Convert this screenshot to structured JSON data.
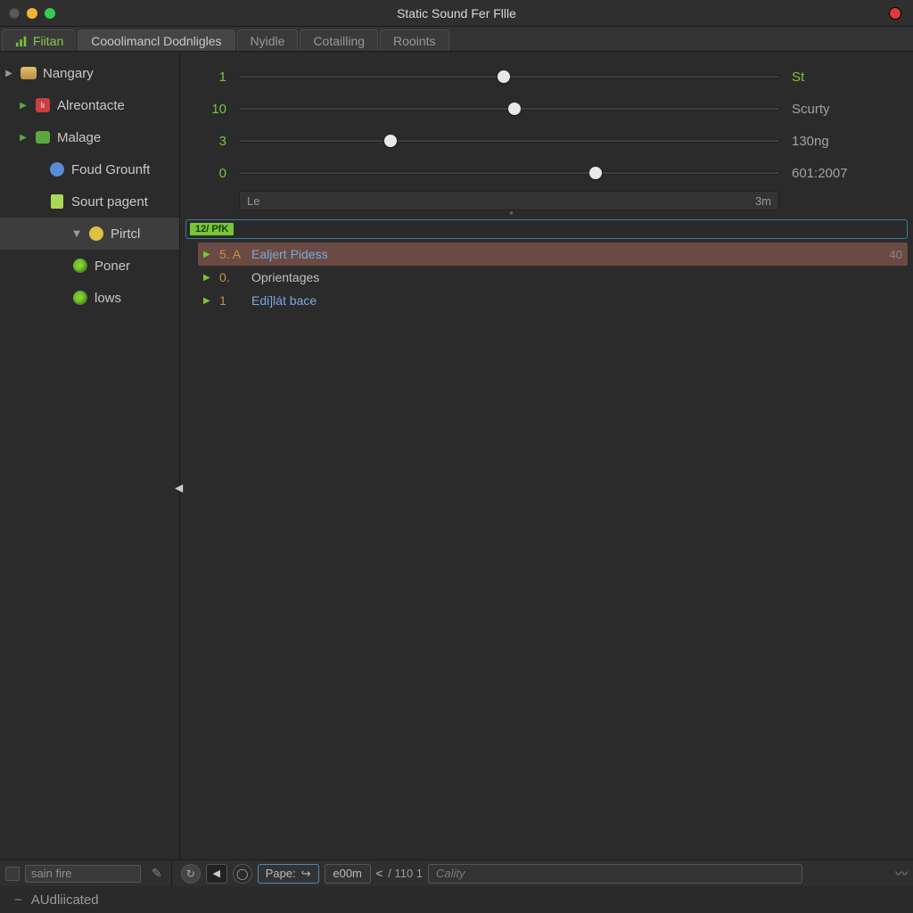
{
  "title": "Static Sound Fer Fllle",
  "tabs": [
    {
      "label": "Fiitan",
      "active": false,
      "accent": "green"
    },
    {
      "label": "Cooolimancl Dodnligles",
      "active": true
    },
    {
      "label": "Nyidle",
      "active": false
    },
    {
      "label": "Cotailling",
      "active": false
    },
    {
      "label": "Rooints",
      "active": false
    }
  ],
  "tree": {
    "n0": {
      "label": "Nangary"
    },
    "n1": {
      "label": "Alreontacte"
    },
    "n2": {
      "label": "Malage"
    },
    "n3": {
      "label": "Foud Grounft"
    },
    "n4": {
      "label": "Sourt pagent"
    },
    "n5": {
      "label": "Pirtcl"
    },
    "n6": {
      "label": "Poner"
    },
    "n7": {
      "label": "lows"
    }
  },
  "sliders": [
    {
      "value": "1",
      "pos": 49,
      "label": "St"
    },
    {
      "value": "10",
      "pos": 51,
      "label": "Scurty"
    },
    {
      "value": "3",
      "pos": 28,
      "label": "130ng"
    },
    {
      "value": "0",
      "pos": 66,
      "label": "601:2007"
    }
  ],
  "ruler": {
    "left": "Le",
    "right": "3m"
  },
  "search_badge": "12/ PfK",
  "results": [
    {
      "num": "5. A",
      "text": "Ealjert Pidess",
      "hl": true,
      "end": "40",
      "color": "blue"
    },
    {
      "num": "0.",
      "text": "Oprientages",
      "hl": false,
      "color": "plain"
    },
    {
      "num": "1",
      "text": "Edi]lát bace",
      "hl": false,
      "color": "blue"
    }
  ],
  "bottom": {
    "name_value": "sain fire",
    "page_label": "Pape:",
    "zoom": "e00m",
    "nav": "/ 110 1",
    "search_placeholder": "Cality",
    "status": "AUdliicated"
  }
}
